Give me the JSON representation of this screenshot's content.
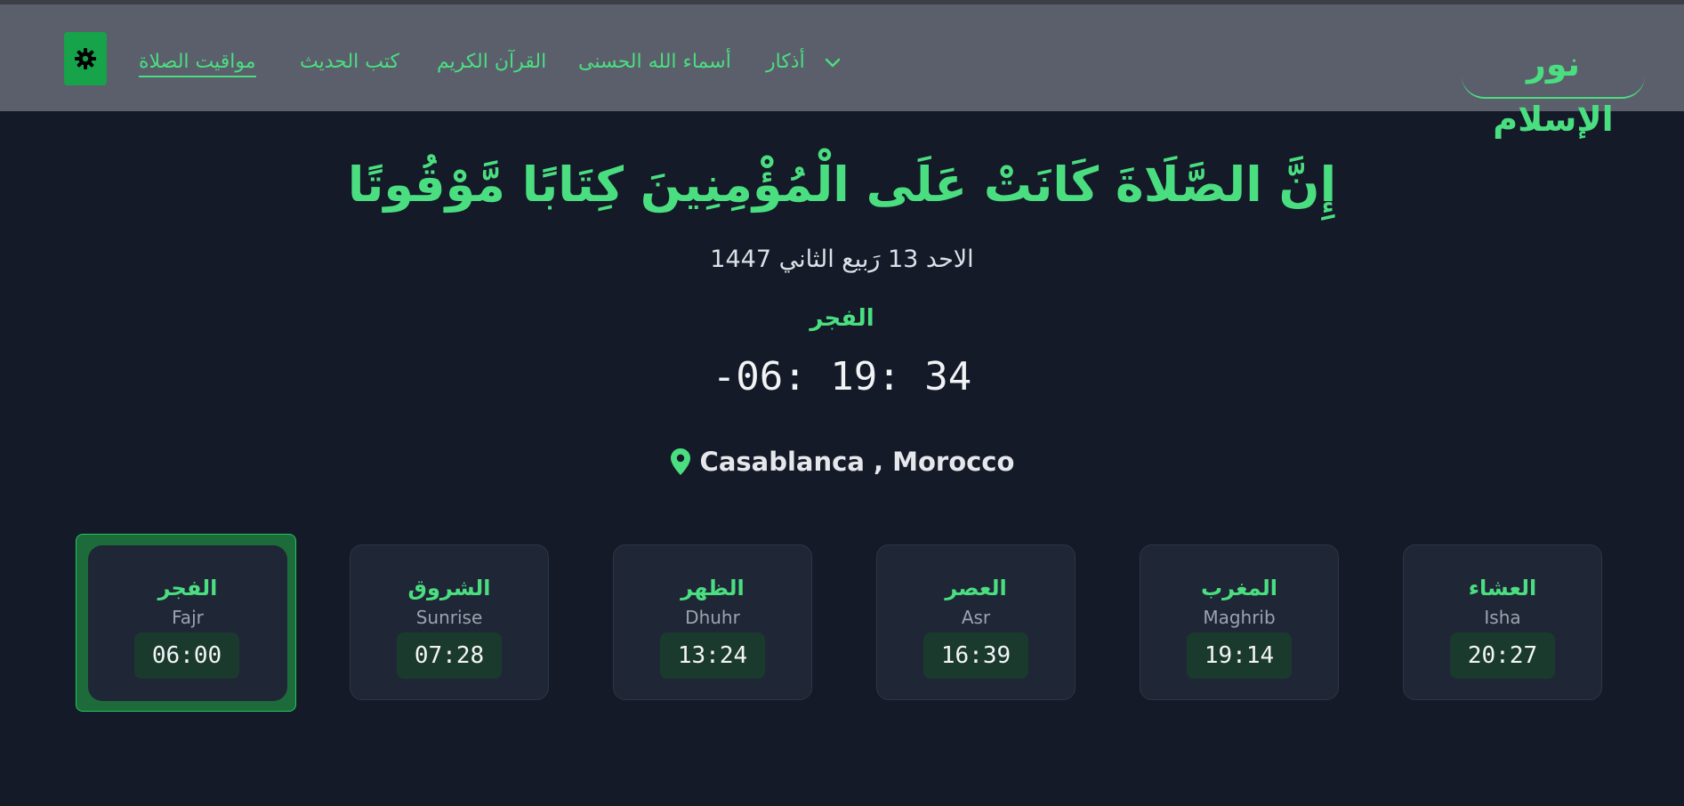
{
  "header": {
    "logo": "نور الإسلام",
    "nav": {
      "prayer_times": "مواقيت الصلاة",
      "hadith_books": "كتب الحديث",
      "quran": "القرآن الكريم",
      "names_of_allah": "أسماء الله الحسنى",
      "adhkar": "أذكار"
    }
  },
  "hero": {
    "verse": "إِنَّ الصَّلَاةَ كَانَتْ عَلَى الْمُؤْمِنِينَ كِتَابًا مَّوْقُوتًا",
    "hijri_date": "الاحد 13 رَبيع الثاني 1447",
    "next_prayer": "الفجر",
    "countdown": "-06: 19: 34",
    "location": "Casablanca , Morocco"
  },
  "prayers": [
    {
      "ar": "الفجر",
      "en": "Fajr",
      "time": "06:00"
    },
    {
      "ar": "الشروق",
      "en": "Sunrise",
      "time": "07:28"
    },
    {
      "ar": "الظهر",
      "en": "Dhuhr",
      "time": "13:24"
    },
    {
      "ar": "العصر",
      "en": "Asr",
      "time": "16:39"
    },
    {
      "ar": "المغرب",
      "en": "Maghrib",
      "time": "19:14"
    },
    {
      "ar": "العشاء",
      "en": "Isha",
      "time": "20:27"
    }
  ],
  "colors": {
    "accent": "#4ade80",
    "background": "#141a28",
    "header": "#5b5f6c",
    "active_card": "#1d6b3b"
  },
  "icons": {
    "theme": "sun-gear-icon",
    "location": "map-pin-icon",
    "dropdown": "chevron-down-icon"
  }
}
